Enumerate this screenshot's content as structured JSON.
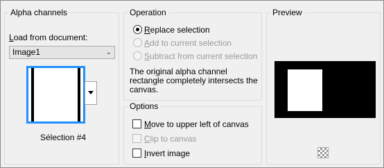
{
  "alpha_group": {
    "title": "Alpha channels",
    "load_label_prefix": "",
    "load_label_accel": "L",
    "load_label_rest": "oad from document:",
    "document_select_value": "Image1",
    "thumbnail_caption": "Sélection #4"
  },
  "operation_group": {
    "title": "Operation",
    "options": [
      {
        "accel": "R",
        "rest": "eplace selection",
        "checked": true,
        "enabled": true
      },
      {
        "accel": "A",
        "rest": "dd to current selection",
        "checked": false,
        "enabled": false
      },
      {
        "accel": "S",
        "rest": "ubtract from current selection",
        "checked": false,
        "enabled": false
      }
    ],
    "message_line1": "The original alpha channel",
    "message_line2": "rectangle completely intersects the",
    "message_line3": "canvas."
  },
  "options_group": {
    "title": "Options",
    "items": [
      {
        "accel": "M",
        "rest": "ove to upper left of canvas",
        "checked": false,
        "enabled": true
      },
      {
        "accel": "C",
        "rest": "lip to canvas",
        "checked": false,
        "enabled": false
      },
      {
        "accel": "I",
        "rest": "nvert image",
        "checked": false,
        "enabled": true
      }
    ]
  },
  "preview_group": {
    "title": "Preview"
  },
  "colors": {
    "thumbnail_border": "#1e90ff",
    "preview_background": "#000000",
    "preview_selection": "#ffffff"
  },
  "icons": {
    "select_arrow": "chevron-down-icon",
    "thumbnail_dropdown": "triangle-down-icon",
    "preview_background": "checkerboard-icon"
  }
}
